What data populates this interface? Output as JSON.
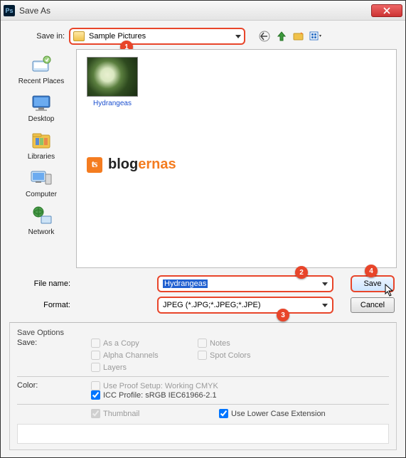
{
  "window": {
    "title": "Save As"
  },
  "savein": {
    "label": "Save in:",
    "value": "Sample Pictures"
  },
  "callouts": {
    "one": "1",
    "two": "2",
    "three": "3",
    "four": "4"
  },
  "places": {
    "recent": "Recent Places",
    "desktop": "Desktop",
    "libraries": "Libraries",
    "computer": "Computer",
    "network": "Network"
  },
  "thumb": {
    "label": "Hydrangeas"
  },
  "watermark": {
    "part1": "blog",
    "part2": "ernas"
  },
  "fields": {
    "filename_label": "File name:",
    "filename_value": "Hydrangeas",
    "format_label": "Format:",
    "format_value": "JPEG (*.JPG;*.JPEG;*.JPE)"
  },
  "buttons": {
    "save": "Save",
    "cancel": "Cancel"
  },
  "options": {
    "header": "Save Options",
    "save_label": "Save:",
    "as_copy": "As a Copy",
    "notes": "Notes",
    "alpha": "Alpha Channels",
    "spot": "Spot Colors",
    "layers": "Layers",
    "color_label": "Color:",
    "proof": "Use Proof Setup:  Working CMYK",
    "icc": "ICC Profile: sRGB IEC61966-2.1",
    "thumbnail": "Thumbnail",
    "lowercase": "Use Lower Case Extension"
  }
}
